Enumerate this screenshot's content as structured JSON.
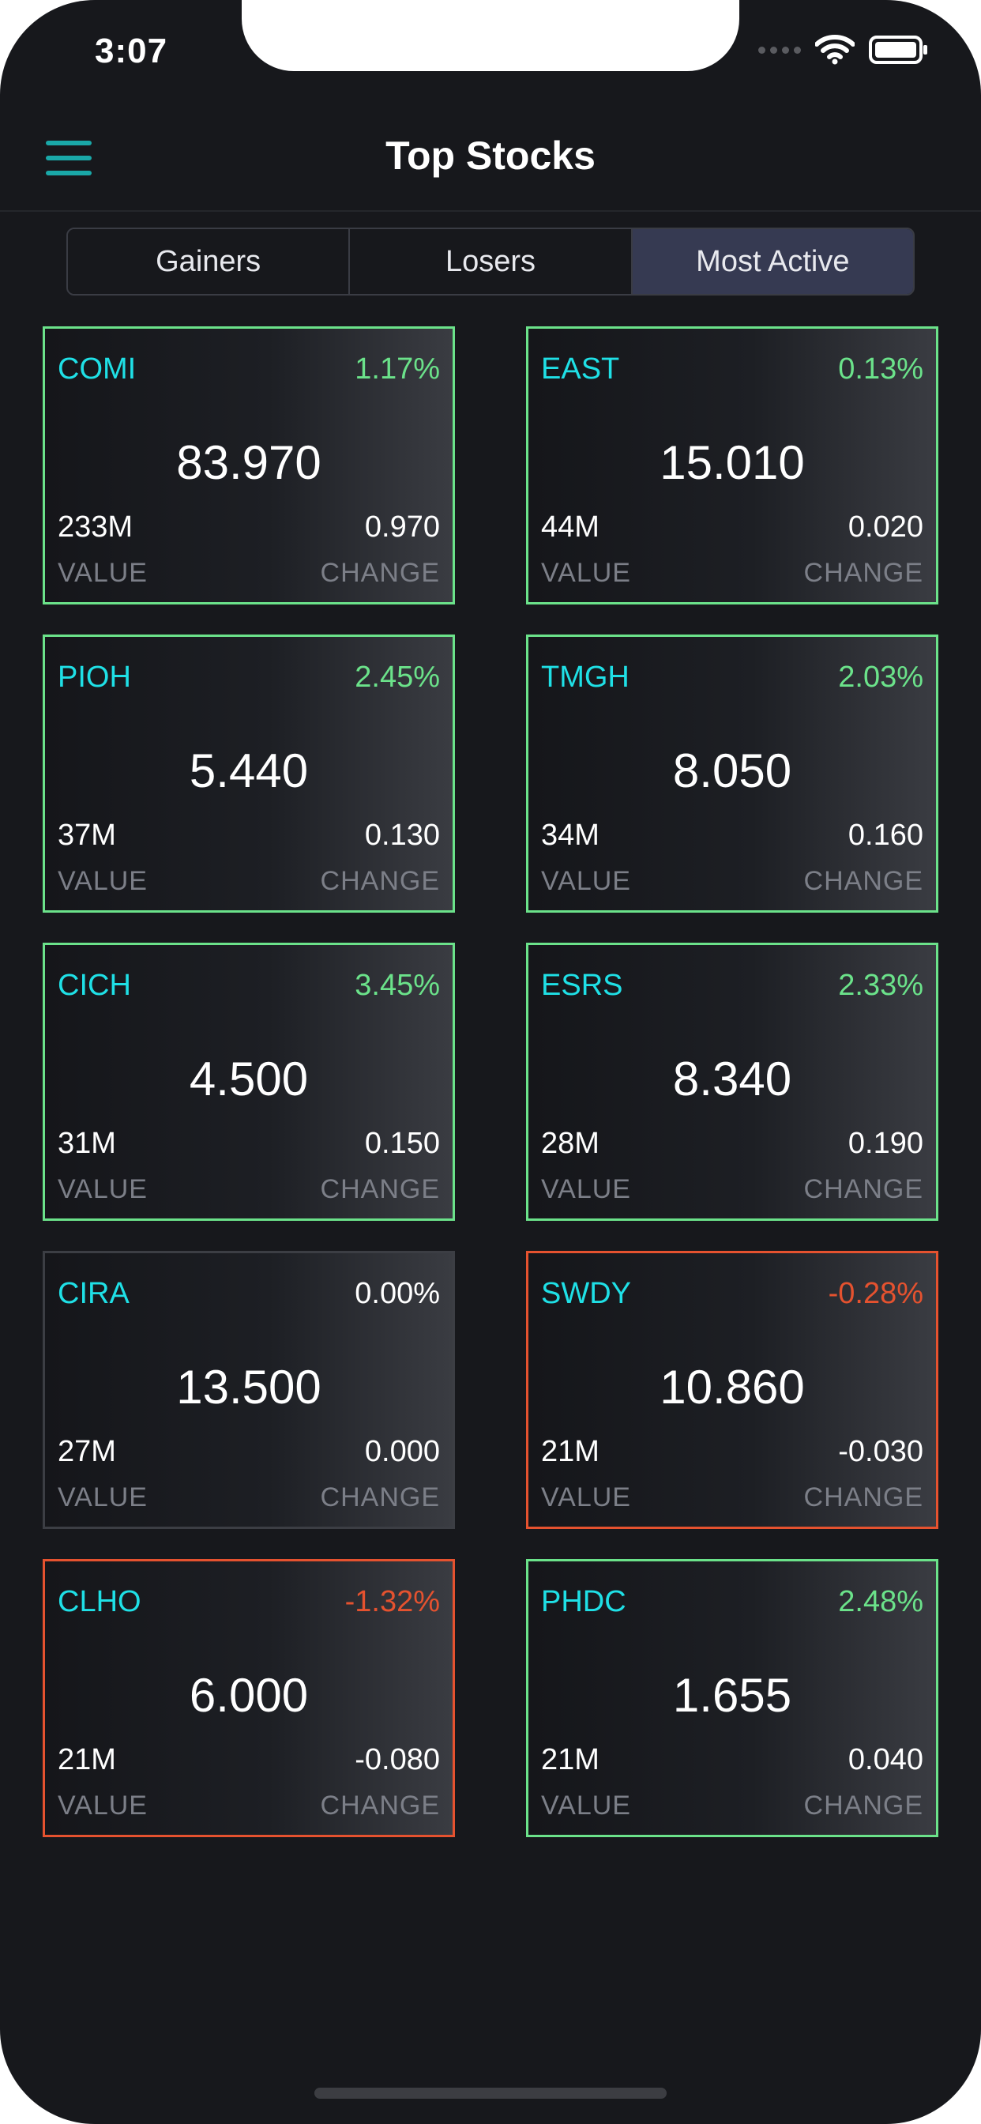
{
  "status_bar": {
    "time": "3:07"
  },
  "header": {
    "title": "Top Stocks"
  },
  "tabs": [
    {
      "label": "Gainers",
      "active": false
    },
    {
      "label": "Losers",
      "active": false
    },
    {
      "label": "Most Active",
      "active": true
    }
  ],
  "labels": {
    "value": "VALUE",
    "change": "CHANGE"
  },
  "colors": {
    "background": "#17181c",
    "symbol": "#1fe0e6",
    "gain": "#6be28a",
    "loss": "#e5522f",
    "accent": "#1aa8a8",
    "active_tab": "#363a52"
  },
  "stocks": [
    {
      "symbol": "COMI",
      "percent": "1.17%",
      "price": "83.970",
      "value": "233M",
      "change": "0.970",
      "trend": "up"
    },
    {
      "symbol": "EAST",
      "percent": "0.13%",
      "price": "15.010",
      "value": "44M",
      "change": "0.020",
      "trend": "up"
    },
    {
      "symbol": "PIOH",
      "percent": "2.45%",
      "price": "5.440",
      "value": "37M",
      "change": "0.130",
      "trend": "up"
    },
    {
      "symbol": "TMGH",
      "percent": "2.03%",
      "price": "8.050",
      "value": "34M",
      "change": "0.160",
      "trend": "up"
    },
    {
      "symbol": "CICH",
      "percent": "3.45%",
      "price": "4.500",
      "value": "31M",
      "change": "0.150",
      "trend": "up"
    },
    {
      "symbol": "ESRS",
      "percent": "2.33%",
      "price": "8.340",
      "value": "28M",
      "change": "0.190",
      "trend": "up"
    },
    {
      "symbol": "CIRA",
      "percent": "0.00%",
      "price": "13.500",
      "value": "27M",
      "change": "0.000",
      "trend": "flat"
    },
    {
      "symbol": "SWDY",
      "percent": "-0.28%",
      "price": "10.860",
      "value": "21M",
      "change": "-0.030",
      "trend": "down"
    },
    {
      "symbol": "CLHO",
      "percent": "-1.32%",
      "price": "6.000",
      "value": "21M",
      "change": "-0.080",
      "trend": "down"
    },
    {
      "symbol": "PHDC",
      "percent": "2.48%",
      "price": "1.655",
      "value": "21M",
      "change": "0.040",
      "trend": "up"
    }
  ]
}
